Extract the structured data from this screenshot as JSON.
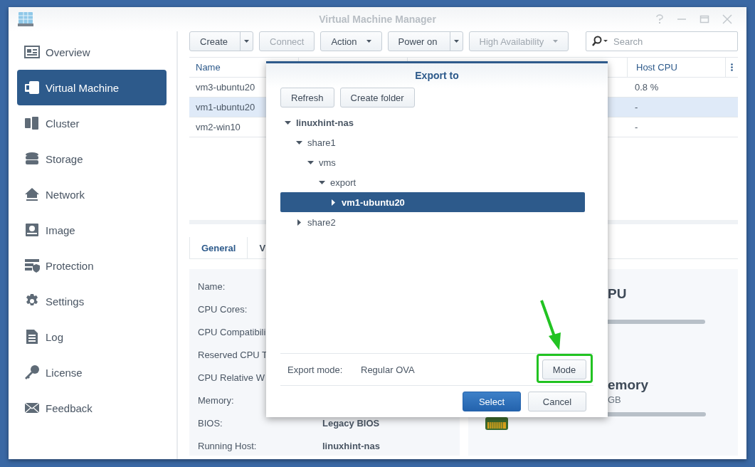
{
  "window": {
    "title": "Virtual Machine Manager"
  },
  "sidebar": {
    "items": [
      {
        "label": "Overview",
        "selected": false
      },
      {
        "label": "Virtual Machine",
        "selected": true
      },
      {
        "label": "Cluster",
        "selected": false
      },
      {
        "label": "Storage",
        "selected": false
      },
      {
        "label": "Network",
        "selected": false
      },
      {
        "label": "Image",
        "selected": false
      },
      {
        "label": "Protection",
        "selected": false
      },
      {
        "label": "Settings",
        "selected": false
      },
      {
        "label": "Log",
        "selected": false
      },
      {
        "label": "License",
        "selected": false
      },
      {
        "label": "Feedback",
        "selected": false
      }
    ]
  },
  "toolbar": {
    "buttons": [
      {
        "label": "Create",
        "kind": "split",
        "disabled": false
      },
      {
        "label": "Connect",
        "kind": "plain",
        "disabled": true
      },
      {
        "label": "Action",
        "kind": "menu",
        "disabled": false
      },
      {
        "label": "Power on",
        "kind": "split",
        "disabled": false
      },
      {
        "label": "High Availability",
        "kind": "menu",
        "disabled": true
      }
    ],
    "search": {
      "placeholder": "Search"
    }
  },
  "table": {
    "columns": [
      "Name",
      "Host CPU"
    ],
    "rows": [
      {
        "name": "vm3-ubuntu20",
        "host_cpu": "0.8 %",
        "selected": false
      },
      {
        "name": "vm1-ubuntu20",
        "host_cpu": "-",
        "selected": true
      },
      {
        "name": "vm2-win10",
        "host_cpu": "-",
        "selected": false
      }
    ]
  },
  "tabs": [
    {
      "label": "General",
      "selected": true
    },
    {
      "label": "V",
      "selected": false
    }
  ],
  "details": [
    {
      "label": "Name:"
    },
    {
      "label": "CPU Cores:"
    },
    {
      "label": "CPU Compatibili"
    },
    {
      "label": "Reserved CPU T"
    },
    {
      "label": "CPU Relative W"
    },
    {
      "label": "Memory:"
    },
    {
      "label": "BIOS:",
      "value": "Legacy BIOS"
    },
    {
      "label": "Running Host:",
      "value": "linuxhint-nas"
    }
  ],
  "resources": [
    {
      "kind": "cpu",
      "title": "PU"
    },
    {
      "kind": "memory",
      "title": "emory",
      "detail": "GB"
    }
  ],
  "dialog": {
    "title": "Export to",
    "buttons": [
      "Refresh",
      "Create folder"
    ],
    "tree": [
      {
        "label": "linuxhint-nas",
        "expanded": true,
        "selected": false,
        "children": [
          {
            "label": "share1",
            "expanded": true,
            "selected": false,
            "children": [
              {
                "label": "vms",
                "expanded": true,
                "selected": false,
                "children": [
                  {
                    "label": "export",
                    "expanded": true,
                    "selected": false,
                    "children": [
                      {
                        "label": "vm1-ubuntu20",
                        "expanded": false,
                        "selected": true
                      }
                    ]
                  }
                ]
              }
            ]
          },
          {
            "label": "share2",
            "expanded": false,
            "selected": false
          }
        ]
      }
    ],
    "export_mode": {
      "label": "Export mode:",
      "value": "Regular OVA",
      "button": "Mode"
    },
    "actions": [
      {
        "label": "Select",
        "kind": "primary"
      },
      {
        "label": "Cancel",
        "kind": "default"
      }
    ]
  }
}
